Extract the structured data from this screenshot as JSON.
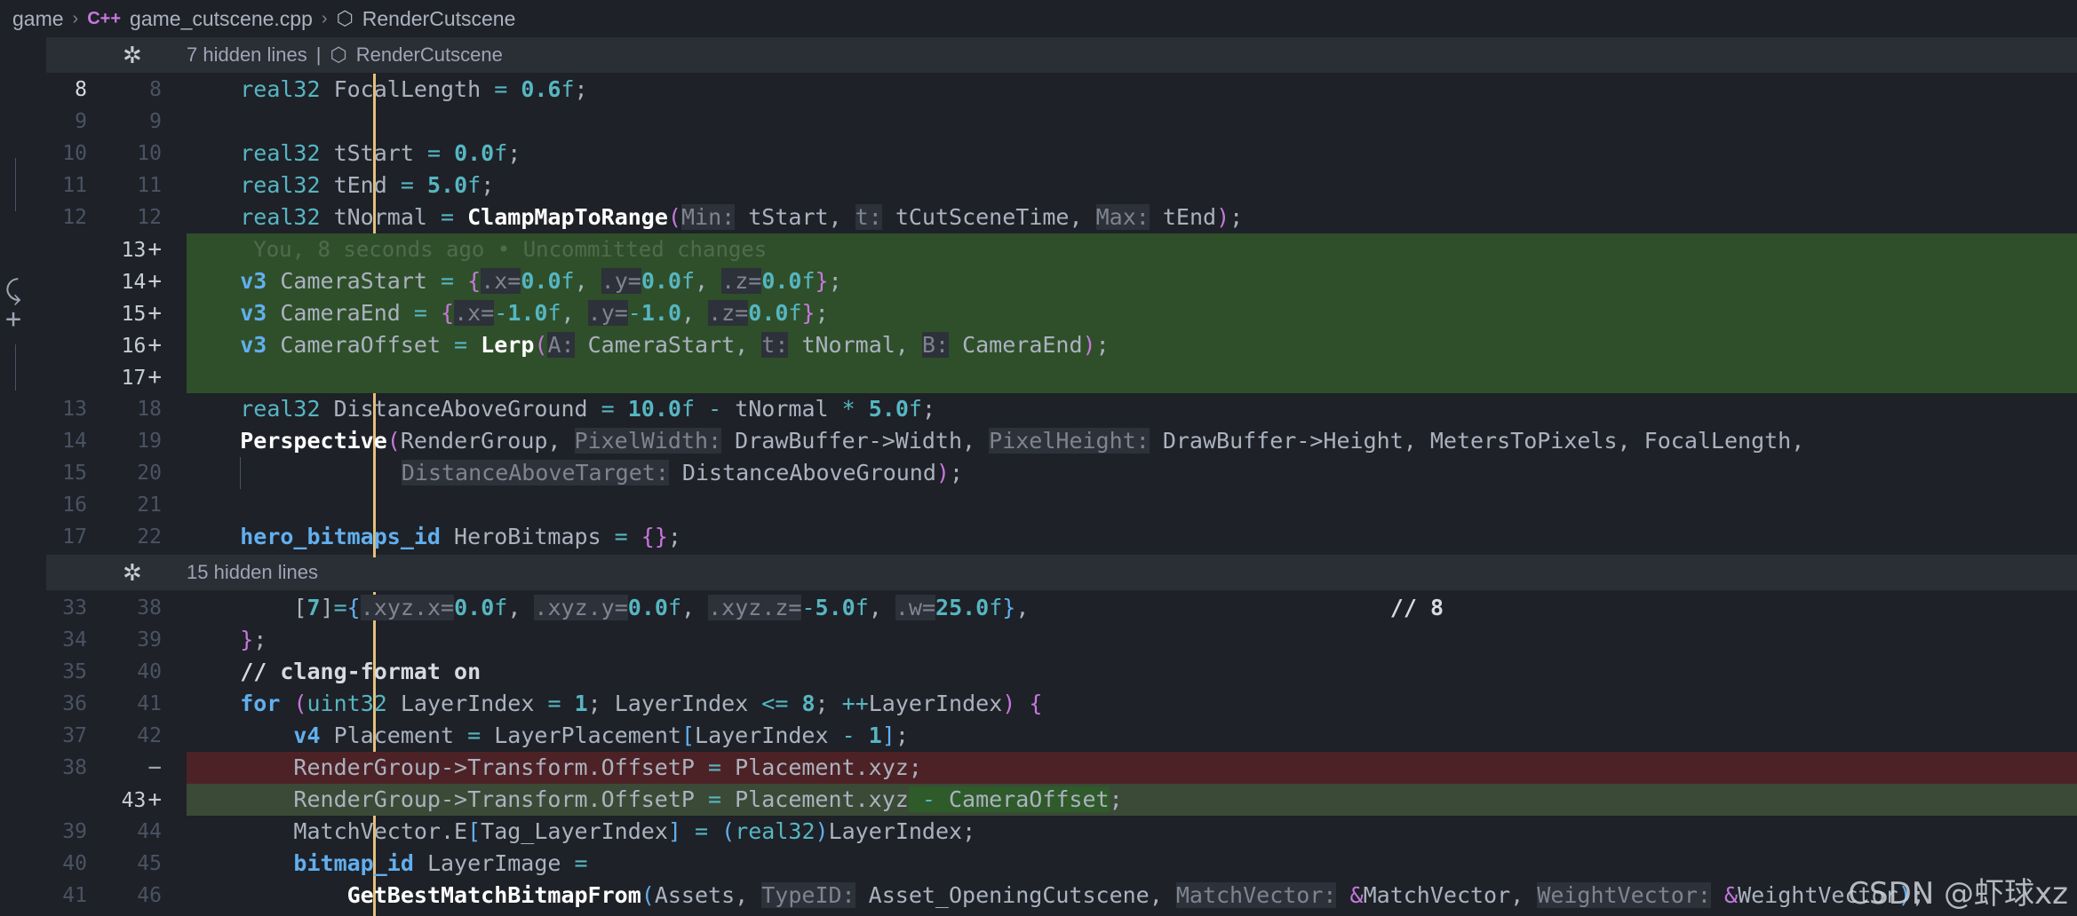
{
  "breadcrumb": {
    "folder": "game",
    "file": "game_cutscene.cpp",
    "symbol": "RenderCutscene",
    "cpp_badge": "C++"
  },
  "fold_top": {
    "text": "7 hidden lines",
    "divider": "|",
    "symbol": "RenderCutscene"
  },
  "fold_mid": {
    "text": "15 hidden lines"
  },
  "blame_hint": "You, 8 seconds ago • Uncommitted changes",
  "rows": [
    {
      "old": "8",
      "new": "8"
    },
    {
      "old": "9",
      "new": "9"
    },
    {
      "old": "10",
      "new": "10"
    },
    {
      "old": "11",
      "new": "11"
    },
    {
      "old": "12",
      "new": "12"
    },
    {
      "old": "",
      "new": "13"
    },
    {
      "old": "",
      "new": "14"
    },
    {
      "old": "",
      "new": "15"
    },
    {
      "old": "",
      "new": "16"
    },
    {
      "old": "",
      "new": "17"
    },
    {
      "old": "13",
      "new": "18"
    },
    {
      "old": "14",
      "new": "19"
    },
    {
      "old": "15",
      "new": "20"
    },
    {
      "old": "16",
      "new": "21"
    },
    {
      "old": "17",
      "new": "22"
    },
    {
      "old": "33",
      "new": "38"
    },
    {
      "old": "34",
      "new": "39"
    },
    {
      "old": "35",
      "new": "40"
    },
    {
      "old": "36",
      "new": "41"
    },
    {
      "old": "37",
      "new": "42"
    },
    {
      "old": "38",
      "new": ""
    },
    {
      "old": "",
      "new": "43"
    },
    {
      "old": "39",
      "new": "44"
    },
    {
      "old": "40",
      "new": "45"
    },
    {
      "old": "41",
      "new": "46"
    }
  ],
  "plus": "+",
  "minus": "−",
  "watermark": "CSDN @虾球xz",
  "colors": {
    "added_bg": "#2f4f2a",
    "deleted_bg": "#4d2226",
    "modified_bar": "#e5c07b",
    "added_bar": "#98c379"
  }
}
